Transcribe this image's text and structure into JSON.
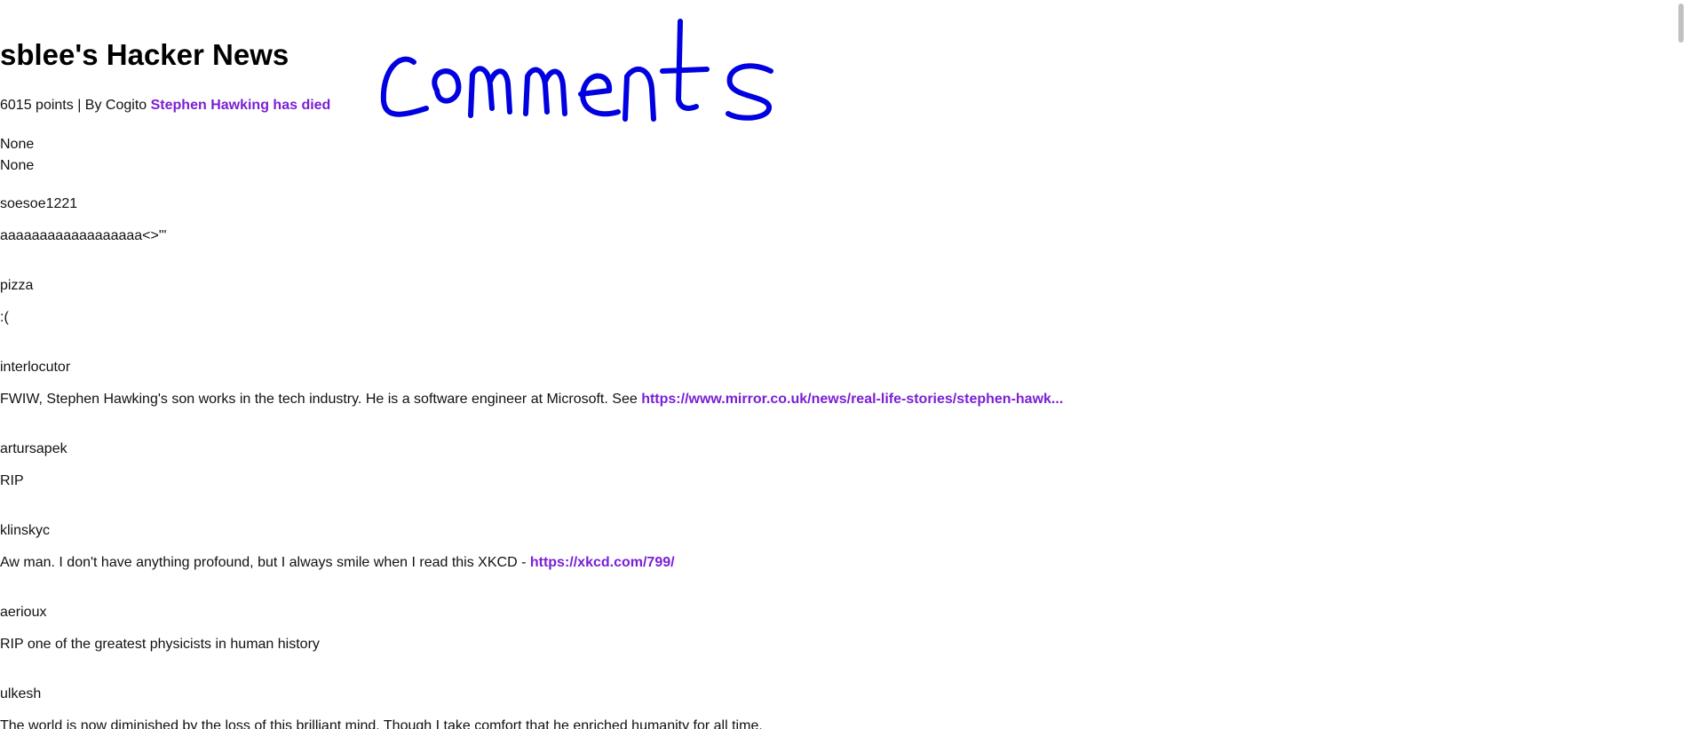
{
  "site": {
    "title": "sblee's Hacker News"
  },
  "story": {
    "points": "6015 points",
    "separator": "|",
    "by_label": "By",
    "author": "Cogito",
    "title": "Stephen Hawking has died",
    "body_lines": [
      "None",
      "None"
    ]
  },
  "comments": [
    {
      "author": "soesoe1221",
      "text": "aaaaaaaaaaaaaaaaaa<>\"'",
      "link": ""
    },
    {
      "author": "pizza",
      "text": ":(",
      "link": ""
    },
    {
      "author": "interlocutor",
      "text": "FWIW, Stephen Hawking's son works in the tech industry. He is a software engineer at Microsoft. See ",
      "link": "https://www.mirror.co.uk/news/real-life-stories/stephen-hawk..."
    },
    {
      "author": "artursapek",
      "text": "RIP",
      "link": ""
    },
    {
      "author": "klinskyc",
      "text": "Aw man. I don't have anything profound, but I always smile when I read this XKCD - ",
      "link": "https://xkcd.com/799/"
    },
    {
      "author": "aerioux",
      "text": "RIP one of the greatest physicists in human history",
      "link": ""
    },
    {
      "author": "ulkesh",
      "text": "The world is now diminished by the loss of this brilliant mind. Though I take comfort that he enriched humanity for all time.",
      "link": ""
    }
  ],
  "annotation": {
    "handwritten_text": "comments",
    "ink_color": "#0000e0"
  },
  "colors": {
    "link": "#7a1fd6",
    "text": "#111111",
    "background": "#ffffff"
  }
}
